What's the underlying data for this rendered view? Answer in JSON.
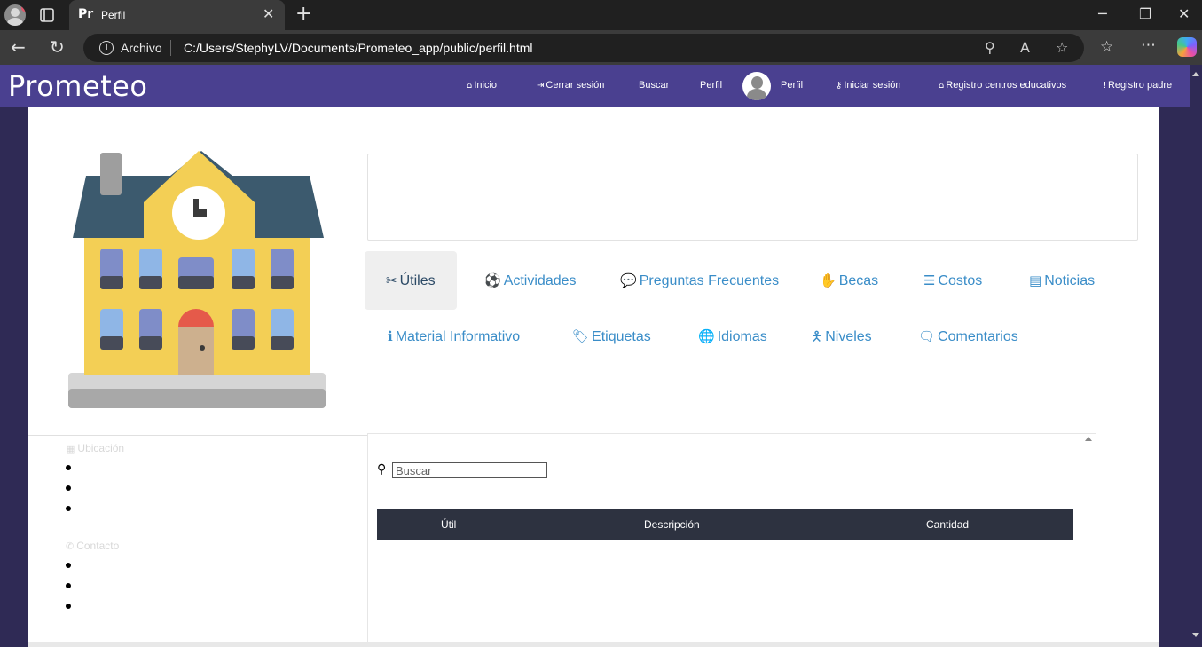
{
  "browser": {
    "tab_favicon": "Pr",
    "tab_title": "Perfil",
    "address_scheme": "Archivo",
    "address_url": "C:/Users/StephyLV/Documents/Prometeo_app/public/perfil.html"
  },
  "navbar": {
    "logo": "Prometeo",
    "items": [
      {
        "icon": "home-icon",
        "label": "Inicio"
      },
      {
        "icon": "sign-out-icon",
        "label": "Cerrar sesión"
      },
      {
        "label": "Buscar"
      },
      {
        "label": "Perfil"
      },
      {
        "label": "Perfil"
      },
      {
        "icon": "key-icon",
        "label": "Iniciar sesión"
      },
      {
        "icon": "school-icon",
        "label": "Registro centros educativos"
      },
      {
        "icon": "male-icon",
        "label": "Registro padre"
      }
    ]
  },
  "profile_tabs": [
    {
      "icon": "tools-icon",
      "label": "Útiles",
      "active": true
    },
    {
      "icon": "soccer-ball-icon",
      "label": "Actividades"
    },
    {
      "icon": "comment-icon",
      "label": "Preguntas Frecuentes"
    },
    {
      "icon": "handshake-icon",
      "label": "Becas"
    },
    {
      "icon": "coins-icon",
      "label": "Costos"
    },
    {
      "icon": "newspaper-icon",
      "label": "Noticias"
    },
    {
      "icon": "info-icon",
      "label": "Material Informativo"
    },
    {
      "icon": "tags-icon",
      "label": "Etiquetas"
    },
    {
      "icon": "globe-icon",
      "label": "Idiomas"
    },
    {
      "icon": "child-icon",
      "label": "Niveles"
    },
    {
      "icon": "comments-icon",
      "label": "Comentarios"
    }
  ],
  "sidebar": {
    "location_title": "Ubicación",
    "contact_title": "Contacto"
  },
  "table": {
    "search_placeholder": "Buscar",
    "columns": [
      "Útil",
      "Descripción",
      "Cantidad"
    ]
  }
}
